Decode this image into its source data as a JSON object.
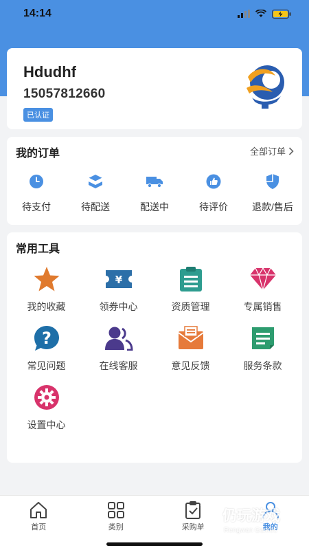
{
  "status_bar": {
    "time": "14:14"
  },
  "profile": {
    "name": "Hdudhf",
    "phone": "15057812660",
    "badge": "已认证"
  },
  "orders": {
    "title": "我的订单",
    "all_label": "全部订单",
    "items": [
      {
        "label": "待支付",
        "icon": "clock-icon"
      },
      {
        "label": "待配送",
        "icon": "package-icon"
      },
      {
        "label": "配送中",
        "icon": "truck-icon"
      },
      {
        "label": "待评价",
        "icon": "thumbs-up-icon"
      },
      {
        "label": "退款/售后",
        "icon": "shield-icon"
      }
    ]
  },
  "tools": {
    "title": "常用工具",
    "items": [
      {
        "label": "我的收藏",
        "icon": "star-icon"
      },
      {
        "label": "领券中心",
        "icon": "coupon-icon"
      },
      {
        "label": "资质管理",
        "icon": "clipboard-icon"
      },
      {
        "label": "专属销售",
        "icon": "diamond-icon"
      },
      {
        "label": "常见问题",
        "icon": "question-icon"
      },
      {
        "label": "在线客服",
        "icon": "customer-service-icon"
      },
      {
        "label": "意见反馈",
        "icon": "envelope-icon"
      },
      {
        "label": "服务条款",
        "icon": "document-icon"
      },
      {
        "label": "设置中心",
        "icon": "settings-icon"
      }
    ]
  },
  "tabbar": {
    "items": [
      {
        "label": "首页",
        "icon": "home-icon"
      },
      {
        "label": "类别",
        "icon": "grid-icon"
      },
      {
        "label": "采购单",
        "icon": "purchase-list-icon"
      },
      {
        "label": "我的",
        "icon": "user-icon",
        "active": true
      }
    ]
  },
  "watermark": {
    "title": "仍玩游戏",
    "subtitle": "Rengwan Games"
  },
  "colors": {
    "brand_blue": "#4a90e2",
    "star": "#e07a2e",
    "coupon": "#2c6fa8",
    "clipboard": "#2d9c8f",
    "diamond": "#d8336b",
    "question": "#1e6fa8",
    "service": "#4b3a8c",
    "envelope": "#e67a3a",
    "document": "#2d9c6f",
    "settings": "#d8336b"
  }
}
